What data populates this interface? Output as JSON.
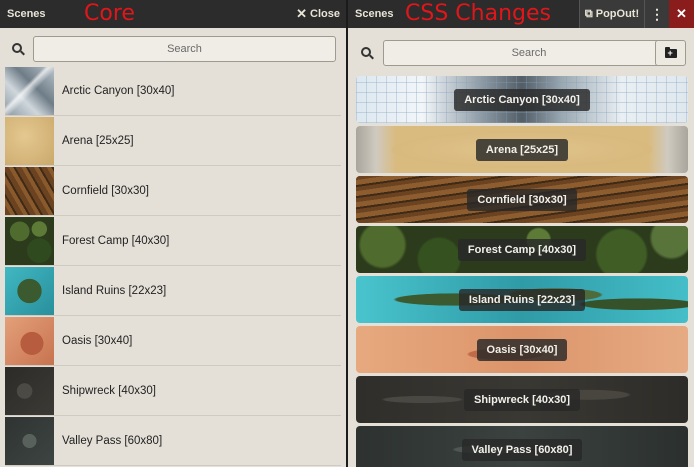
{
  "left": {
    "title": "Scenes",
    "annotation": "Core",
    "close_label": "Close",
    "search_placeholder": "Search",
    "scenes": [
      {
        "name": "Arctic Canyon [30x40]",
        "texture": "arctic"
      },
      {
        "name": "Arena [25x25]",
        "texture": "arena"
      },
      {
        "name": "Cornfield [30x30]",
        "texture": "corn"
      },
      {
        "name": "Forest Camp [40x30]",
        "texture": "forest"
      },
      {
        "name": "Island Ruins [22x23]",
        "texture": "island"
      },
      {
        "name": "Oasis [30x40]",
        "texture": "oasis"
      },
      {
        "name": "Shipwreck [40x30]",
        "texture": "ship"
      },
      {
        "name": "Valley Pass [60x80]",
        "texture": "valley"
      }
    ]
  },
  "right": {
    "title": "Scenes",
    "annotation": "CSS Changes",
    "popout_label": "PopOut!",
    "search_placeholder": "Search",
    "scenes": [
      {
        "name": "Arctic Canyon [30x40]",
        "texture": "arctic-wide"
      },
      {
        "name": "Arena [25x25]",
        "texture": "arena-wide"
      },
      {
        "name": "Cornfield [30x30]",
        "texture": "corn-wide"
      },
      {
        "name": "Forest Camp [40x30]",
        "texture": "forest-wide"
      },
      {
        "name": "Island Ruins [22x23]",
        "texture": "island-wide"
      },
      {
        "name": "Oasis [30x40]",
        "texture": "oasis-wide"
      },
      {
        "name": "Shipwreck [40x30]",
        "texture": "ship-wide"
      },
      {
        "name": "Valley Pass [60x80]",
        "texture": "valley-wide"
      }
    ]
  }
}
